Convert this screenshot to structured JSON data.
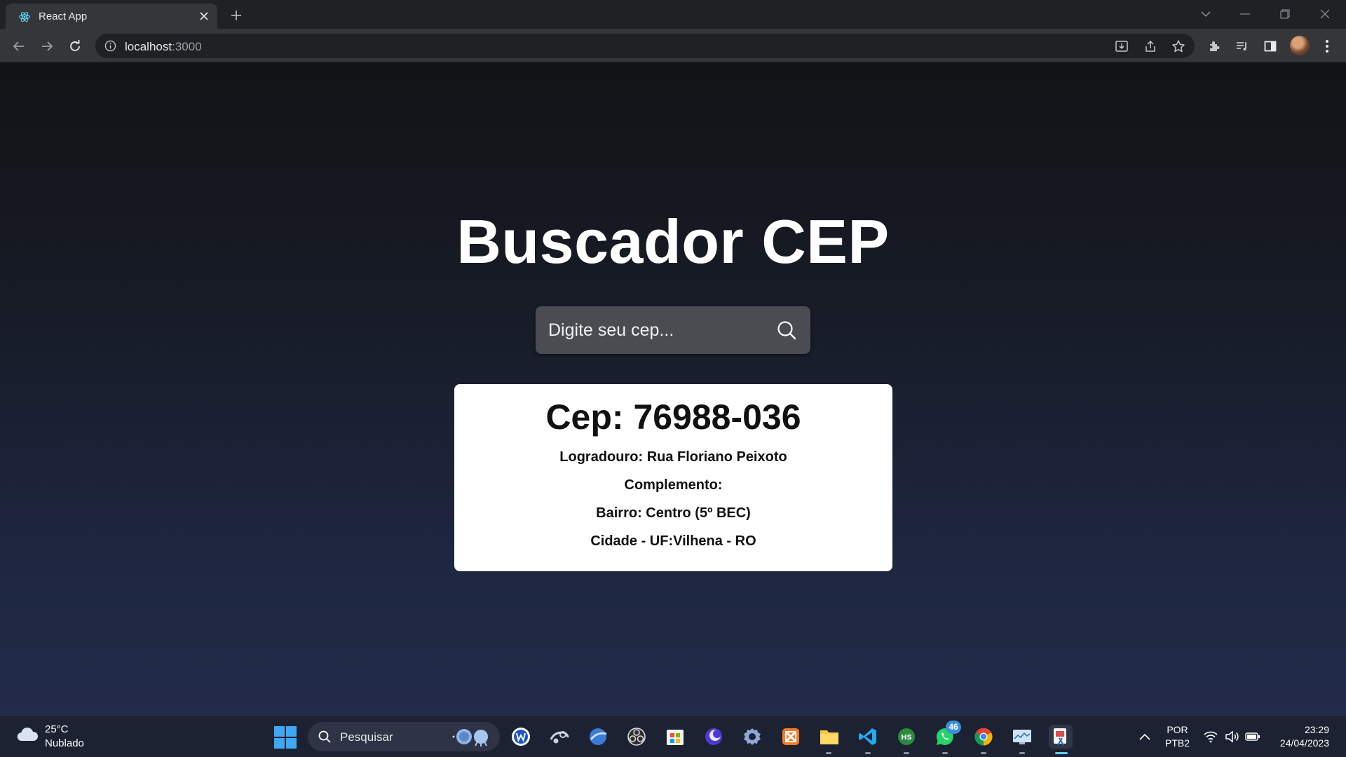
{
  "browser": {
    "tab_title": "React App",
    "url_host": "localhost",
    "url_port": ":3000"
  },
  "app": {
    "title": "Buscador CEP",
    "search_placeholder": "Digite seu cep...",
    "result": {
      "cep": "Cep: 76988-036",
      "logradouro": "Logradouro: Rua Floriano Peixoto",
      "complemento": "Complemento:",
      "bairro": "Bairro: Centro (5º BEC)",
      "cidade": "Cidade - UF:Vilhena - RO"
    }
  },
  "taskbar": {
    "weather_temp": "25°C",
    "weather_desc": "Nublado",
    "search_label": "Pesquisar",
    "whatsapp_badge": "46",
    "lang_1": "POR",
    "lang_2": "PTB2",
    "time": "23:29",
    "date": "24/04/2023"
  },
  "colors": {
    "accent_search_bg": "#4a4c52",
    "card_bg": "#ffffff",
    "page_gradient_top": "#121316",
    "page_gradient_bottom": "#222b48"
  }
}
